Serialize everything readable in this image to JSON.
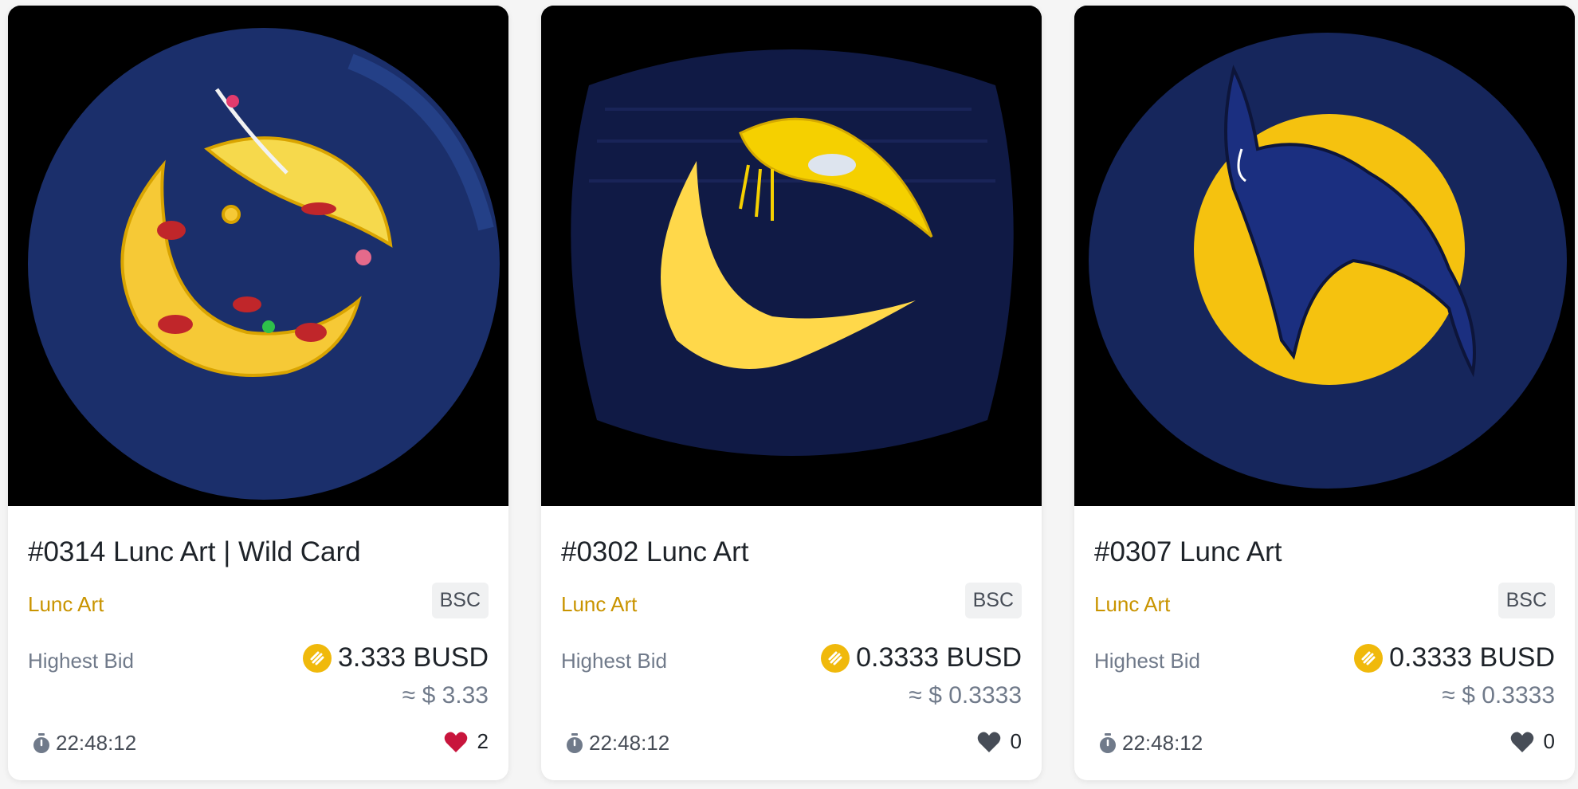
{
  "cards": [
    {
      "title": "#0314 Lunc Art | Wild Card",
      "collection": "Lunc Art",
      "chain": "BSC",
      "bid_label": "Highest Bid",
      "price": "3.333 BUSD",
      "usd": "≈ $ 3.33",
      "timer": "22:48:12",
      "likes": "2",
      "liked": true
    },
    {
      "title": "#0302 Lunc Art",
      "collection": "Lunc Art",
      "chain": "BSC",
      "bid_label": "Highest Bid",
      "price": "0.3333 BUSD",
      "usd": "≈ $ 0.3333",
      "timer": "22:48:12",
      "likes": "0",
      "liked": false
    },
    {
      "title": "#0307 Lunc Art",
      "collection": "Lunc Art",
      "chain": "BSC",
      "bid_label": "Highest Bid",
      "price": "0.3333 BUSD",
      "usd": "≈ $ 0.3333",
      "timer": "22:48:12",
      "likes": "0",
      "liked": false
    }
  ],
  "colors": {
    "accent": "#c99400",
    "coin": "#f0b90b",
    "liked_heart": "#c8153c",
    "unliked_heart": "#474d57",
    "art_background": "#1b2f6b"
  },
  "icons": {
    "coin": "busd-coin-icon",
    "timer": "stopwatch-icon",
    "like": "heart-icon"
  }
}
